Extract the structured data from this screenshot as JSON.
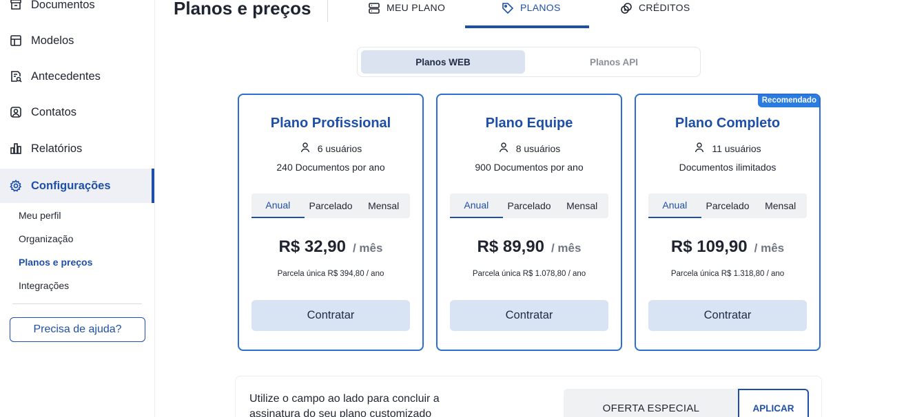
{
  "sidebar": {
    "items": [
      {
        "label": "Documentos",
        "icon": "archive-icon"
      },
      {
        "label": "Modelos",
        "icon": "layout-icon"
      },
      {
        "label": "Antecedentes",
        "icon": "document-search-icon"
      },
      {
        "label": "Contatos",
        "icon": "contact-icon"
      },
      {
        "label": "Relatórios",
        "icon": "bar-chart-icon"
      },
      {
        "label": "Configurações",
        "icon": "gear-icon"
      }
    ],
    "subitems": [
      "Meu perfil",
      "Organização",
      "Planos e preços",
      "Integrações"
    ],
    "help_button": "Precisa de ajuda?"
  },
  "header": {
    "title": "Planos e preços",
    "tabs": [
      {
        "label": "MEU PLANO",
        "icon": "server-icon"
      },
      {
        "label": "PLANOS",
        "icon": "tag-icon"
      },
      {
        "label": "CRÉDITOS",
        "icon": "coins-icon"
      }
    ]
  },
  "toggle": {
    "web": "Planos WEB",
    "api": "Planos API"
  },
  "plans": [
    {
      "name": "Plano Profissional",
      "users": "6 usuários",
      "docs": "240 Documentos por ano",
      "periods": [
        "Anual",
        "Parcelado",
        "Mensal"
      ],
      "price": "R$ 32,90",
      "per": "/ mês",
      "installment": "Parcela única R$ 394,80 / ano",
      "cta": "Contratar"
    },
    {
      "name": "Plano Equipe",
      "users": "8 usuários",
      "docs": "900 Documentos por ano",
      "periods": [
        "Anual",
        "Parcelado",
        "Mensal"
      ],
      "price": "R$ 89,90",
      "per": "/ mês",
      "installment": "Parcela única R$ 1.078,80 / ano",
      "cta": "Contratar"
    },
    {
      "name": "Plano Completo",
      "badge": "Recomendado",
      "users": "11 usuários",
      "docs": "Documentos ilimitados",
      "periods": [
        "Anual",
        "Parcelado",
        "Mensal"
      ],
      "price": "R$ 109,90",
      "per": "/ mês",
      "installment": "Parcela única R$ 1.318,80 / ano",
      "cta": "Contratar"
    }
  ],
  "coupon": {
    "text": "Utilize o campo ao lado para concluir a assinatura do seu plano customizado",
    "field_value": "OFERTA ESPECIAL",
    "apply_label": "APLICAR"
  },
  "colors": {
    "accent": "#1e4fa8",
    "card_border": "#2b6dd0",
    "button_bg": "#d8e3f3",
    "badge": "#2b7ce0"
  }
}
